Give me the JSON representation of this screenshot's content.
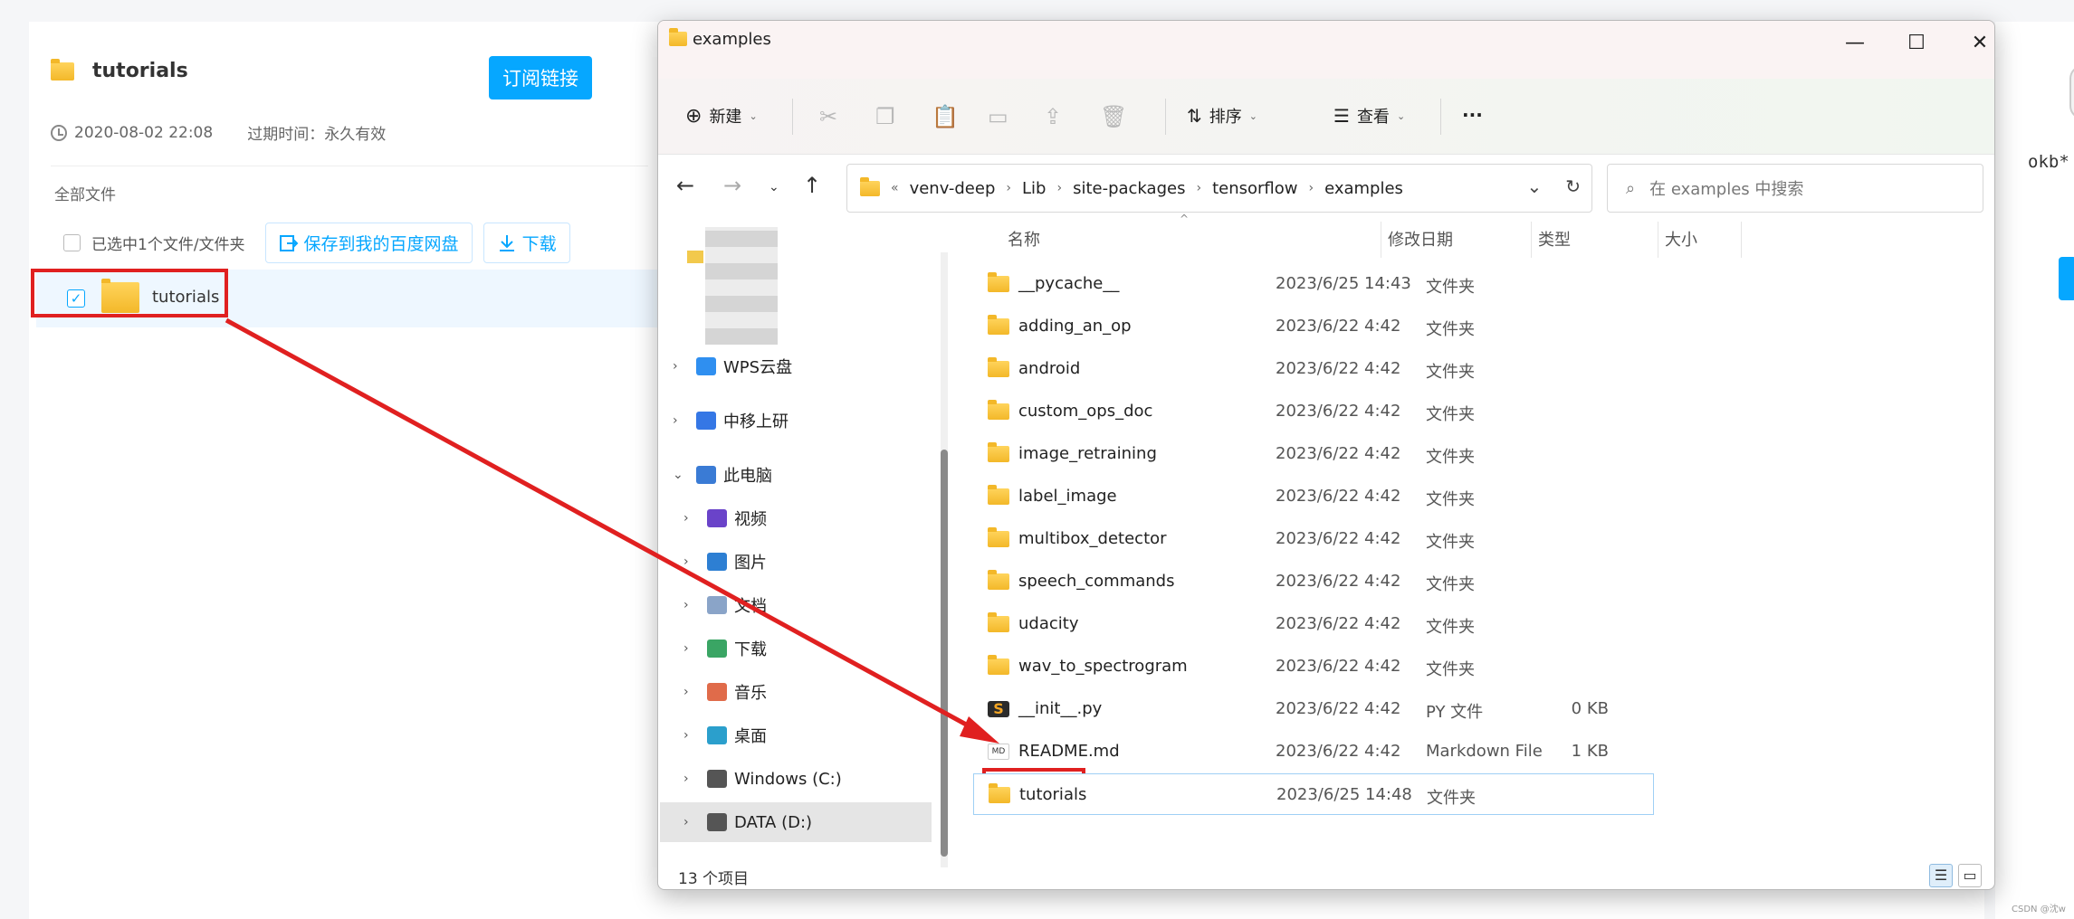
{
  "share_page": {
    "title": "tutorials",
    "subscribe_label": "订阅链接",
    "created": "2020-08-02 22:08",
    "expire_label": "过期时间：永久有效",
    "all_files_label": "全部文件",
    "selected_label": "已选中1个文件/文件夹",
    "save_label": "保存到我的百度网盘",
    "download_label": "下载",
    "row_name": "tutorials",
    "right_text": "okb*",
    "watermark": "CSDN @沈w",
    "accent_color": "#06a7ff",
    "highlight_color": "#e02020"
  },
  "explorer": {
    "window_title": "examples",
    "toolbar": {
      "new_label": "新建",
      "sort_label": "排序",
      "view_label": "查看",
      "more_label": "···"
    },
    "address": {
      "prefix": "«",
      "segments": [
        "venv-deep",
        "Lib",
        "site-packages",
        "tensorflow",
        "examples"
      ]
    },
    "search_placeholder": "在 examples 中搜索",
    "nav": [
      {
        "label": "WPS云盘",
        "icon": "cloud-icon"
      },
      {
        "label": "中移上研",
        "icon": "building-icon"
      },
      {
        "label": "此电脑",
        "icon": "computer-icon"
      },
      {
        "label": "视频",
        "icon": "video-icon"
      },
      {
        "label": "图片",
        "icon": "picture-icon"
      },
      {
        "label": "文档",
        "icon": "document-icon"
      },
      {
        "label": "下载",
        "icon": "download-icon"
      },
      {
        "label": "音乐",
        "icon": "music-icon"
      },
      {
        "label": "桌面",
        "icon": "desktop-icon"
      },
      {
        "label": "Windows (C:)",
        "icon": "drive-icon"
      },
      {
        "label": "DATA (D:)",
        "icon": "drive-icon"
      }
    ],
    "columns": {
      "name": "名称",
      "date": "修改日期",
      "type": "类型",
      "size": "大小"
    },
    "files": [
      {
        "name": "__pycache__",
        "date": "2023/6/25 14:43",
        "type": "文件夹",
        "size": "",
        "kind": "folder"
      },
      {
        "name": "adding_an_op",
        "date": "2023/6/22 4:42",
        "type": "文件夹",
        "size": "",
        "kind": "folder"
      },
      {
        "name": "android",
        "date": "2023/6/22 4:42",
        "type": "文件夹",
        "size": "",
        "kind": "folder"
      },
      {
        "name": "custom_ops_doc",
        "date": "2023/6/22 4:42",
        "type": "文件夹",
        "size": "",
        "kind": "folder"
      },
      {
        "name": "image_retraining",
        "date": "2023/6/22 4:42",
        "type": "文件夹",
        "size": "",
        "kind": "folder"
      },
      {
        "name": "label_image",
        "date": "2023/6/22 4:42",
        "type": "文件夹",
        "size": "",
        "kind": "folder"
      },
      {
        "name": "multibox_detector",
        "date": "2023/6/22 4:42",
        "type": "文件夹",
        "size": "",
        "kind": "folder"
      },
      {
        "name": "speech_commands",
        "date": "2023/6/22 4:42",
        "type": "文件夹",
        "size": "",
        "kind": "folder"
      },
      {
        "name": "udacity",
        "date": "2023/6/22 4:42",
        "type": "文件夹",
        "size": "",
        "kind": "folder"
      },
      {
        "name": "wav_to_spectrogram",
        "date": "2023/6/22 4:42",
        "type": "文件夹",
        "size": "",
        "kind": "folder"
      },
      {
        "name": "__init__.py",
        "date": "2023/6/22 4:42",
        "type": "PY 文件",
        "size": "0 KB",
        "kind": "py"
      },
      {
        "name": "README.md",
        "date": "2023/6/22 4:42",
        "type": "Markdown File",
        "size": "1 KB",
        "kind": "md"
      },
      {
        "name": "tutorials",
        "date": "2023/6/25 14:48",
        "type": "文件夹",
        "size": "",
        "kind": "folder"
      }
    ],
    "status": "13 个项目"
  }
}
